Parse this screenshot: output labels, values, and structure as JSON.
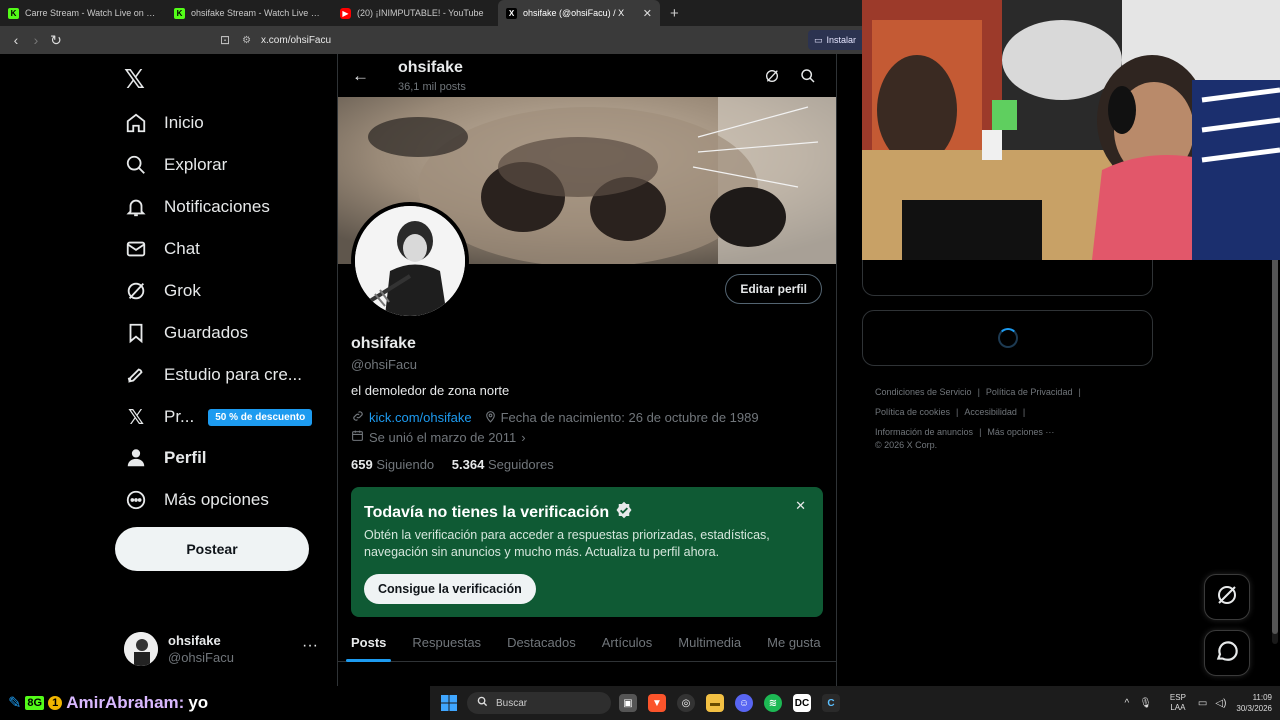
{
  "browser": {
    "tabs": [
      {
        "title": "Carre Stream - Watch Live on Kick",
        "favicon": "kick-icon",
        "active": false
      },
      {
        "title": "ohsifake Stream - Watch Live on Kick",
        "favicon": "kick-icon",
        "active": false
      },
      {
        "title": "(20) ¡INIMPUTABLE! - YouTube",
        "favicon": "youtube-icon",
        "active": false
      },
      {
        "title": "ohsifake (@ohsiFacu) / X",
        "favicon": "x-icon",
        "active": true
      }
    ],
    "url": "x.com/ohsiFacu",
    "install_label": "Instalar"
  },
  "sidebar": {
    "items": [
      {
        "label": "Inicio",
        "icon": "home-icon"
      },
      {
        "label": "Explorar",
        "icon": "search-icon"
      },
      {
        "label": "Notificaciones",
        "icon": "bell-icon"
      },
      {
        "label": "Chat",
        "icon": "mail-icon"
      },
      {
        "label": "Grok",
        "icon": "grok-icon"
      },
      {
        "label": "Guardados",
        "icon": "bookmark-icon"
      },
      {
        "label": "Estudio para cre...",
        "icon": "rocket-icon"
      },
      {
        "label": "Pr...",
        "icon": "x-premium-icon"
      },
      {
        "label": "Perfil",
        "icon": "person-icon"
      },
      {
        "label": "Más opciones",
        "icon": "more-circle-icon"
      }
    ],
    "premium_badge": "50 % de descuento",
    "post_button": "Postear",
    "account": {
      "name": "ohsifake",
      "handle": "@ohsiFacu"
    }
  },
  "profile": {
    "header_name": "ohsifake",
    "header_posts": "36,1 mil posts",
    "edit_button": "Editar perfil",
    "name": "ohsifake",
    "handle": "@ohsiFacu",
    "bio": "el demoledor de zona norte",
    "link": "kick.com/ohsifake",
    "birth": "Fecha de nacimiento: 26 de octubre de 1989",
    "joined": "Se unió el marzo de 2011",
    "following_count": "659",
    "following_label": "Siguiendo",
    "followers_count": "5.364",
    "followers_label": "Seguidores"
  },
  "verification_card": {
    "title": "Todavía no tienes la verificación",
    "body": "Obtén la verificación para acceder a respuestas priorizadas, estadísticas, navegación sin anuncios y mucho más. Actualiza tu perfil ahora.",
    "button": "Consigue la verificación"
  },
  "profile_tabs": [
    "Posts",
    "Respuestas",
    "Destacados",
    "Artículos",
    "Multimedia",
    "Me gusta"
  ],
  "footer": {
    "links": [
      "Condiciones de Servicio",
      "Política de Privacidad",
      "Política de cookies",
      "Accesibilidad",
      "Información de anuncios",
      "Más opciones ···"
    ],
    "copyright": "© 2026 X Corp."
  },
  "chat_overlay": {
    "user": "AmirAbraham:",
    "message": "yo"
  },
  "taskbar": {
    "search_placeholder": "Buscar",
    "lang_top": "ESP",
    "lang_bottom": "LAA",
    "time": "11:09",
    "date": "30/3/2026"
  },
  "colors": {
    "accent": "#1d9bf0",
    "verify_green": "#0f5a34",
    "kick_green": "#53fc18"
  }
}
